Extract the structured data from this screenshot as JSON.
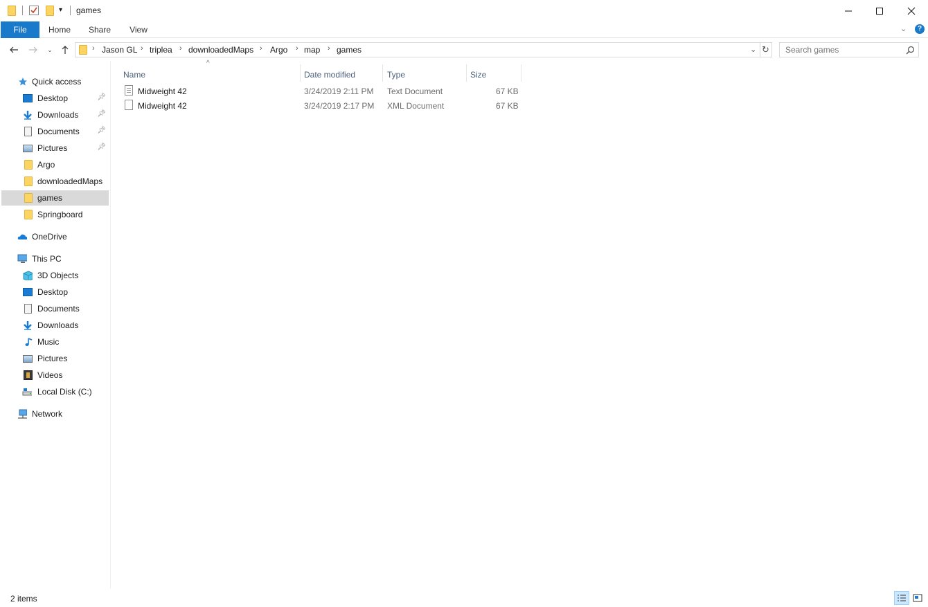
{
  "window": {
    "title": "games",
    "minimize_glyph": "—",
    "maximize_glyph": "☐",
    "close_glyph": "✕"
  },
  "ribbon": {
    "tabs": [
      {
        "label": "File"
      },
      {
        "label": "Home"
      },
      {
        "label": "Share"
      },
      {
        "label": "View"
      }
    ]
  },
  "address": {
    "breadcrumbs": [
      "Jason GL",
      "triplea",
      "downloadedMaps",
      "Argo",
      "map",
      "games"
    ]
  },
  "search": {
    "placeholder": "Search games"
  },
  "navigation": {
    "quick_access": {
      "label": "Quick access",
      "items": [
        {
          "label": "Desktop",
          "pinned": true
        },
        {
          "label": "Downloads",
          "pinned": true
        },
        {
          "label": "Documents",
          "pinned": true
        },
        {
          "label": "Pictures",
          "pinned": true
        },
        {
          "label": "Argo",
          "pinned": false
        },
        {
          "label": "downloadedMaps",
          "pinned": false
        },
        {
          "label": "games",
          "pinned": false,
          "selected": true
        },
        {
          "label": "Springboard",
          "pinned": false
        }
      ]
    },
    "onedrive": {
      "label": "OneDrive"
    },
    "this_pc": {
      "label": "This PC",
      "items": [
        {
          "label": "3D Objects"
        },
        {
          "label": "Desktop"
        },
        {
          "label": "Documents"
        },
        {
          "label": "Downloads"
        },
        {
          "label": "Music"
        },
        {
          "label": "Pictures"
        },
        {
          "label": "Videos"
        },
        {
          "label": "Local Disk (C:)"
        }
      ]
    },
    "network": {
      "label": "Network"
    }
  },
  "file_list": {
    "columns": [
      "Name",
      "Date modified",
      "Type",
      "Size"
    ],
    "sort_column": "Name",
    "rows": [
      {
        "name": "Midweight 42",
        "date": "3/24/2019 2:11 PM",
        "type": "Text Document",
        "size": "67 KB"
      },
      {
        "name": "Midweight 42",
        "date": "3/24/2019 2:17 PM",
        "type": "XML Document",
        "size": "67 KB"
      }
    ]
  },
  "status": {
    "item_count": "2 items"
  },
  "colors": {
    "accent": "#1979ca",
    "folder": "#fcd462",
    "selection": "#d9d9d9"
  }
}
